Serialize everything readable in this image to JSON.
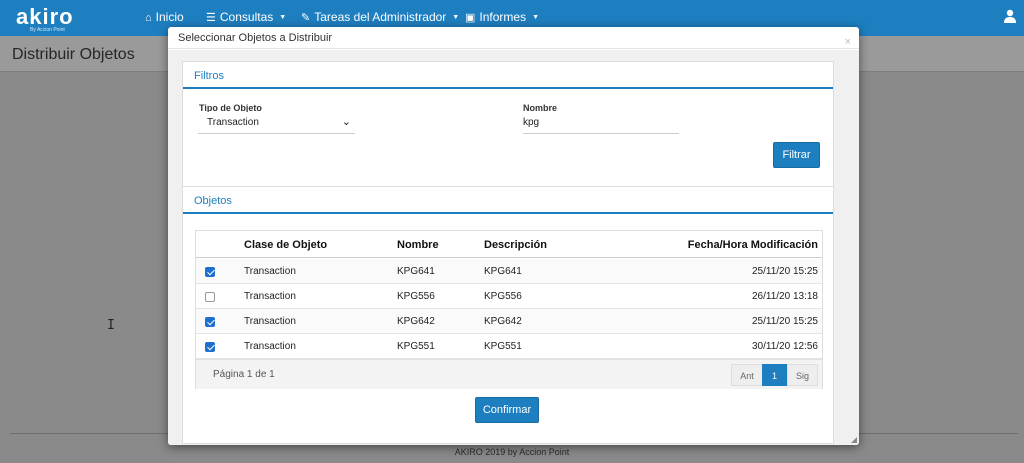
{
  "app": {
    "logo": "akiro",
    "logo_sub": "By Accion Point"
  },
  "nav": [
    {
      "icon": "home-icon",
      "glyph": "⌂",
      "label": "Inicio"
    },
    {
      "icon": "list-icon",
      "glyph": "☰",
      "label": "Consultas"
    },
    {
      "icon": "wrench-icon",
      "glyph": "✎",
      "label": "Tareas del Administrador"
    },
    {
      "icon": "briefcase-icon",
      "glyph": "▣",
      "label": "Informes"
    }
  ],
  "page": {
    "title": "Distribuir Objetos"
  },
  "footer": {
    "text": "AKIRO 2019 by Accion Point"
  },
  "modal": {
    "title": "Seleccionar Objetos a Distribuir",
    "close": "×",
    "filters": {
      "title": "Filtros",
      "type_label": "Tipo de Objeto",
      "type_value": "Transaction",
      "name_label": "Nombre",
      "name_value": "kpg",
      "button": "Filtrar"
    },
    "objects": {
      "title": "Objetos",
      "columns": [
        "Clase de Objeto",
        "Nombre",
        "Descripción",
        "Fecha/Hora Modificación"
      ],
      "rows": [
        {
          "checked": true,
          "clase": "Transaction",
          "nombre": "KPG641",
          "descripcion": "KPG641",
          "fecha": "25/11/20 15:25"
        },
        {
          "checked": false,
          "clase": "Transaction",
          "nombre": "KPG556",
          "descripcion": "KPG556",
          "fecha": "26/11/20 13:18"
        },
        {
          "checked": true,
          "clase": "Transaction",
          "nombre": "KPG642",
          "descripcion": "KPG642",
          "fecha": "25/11/20 15:25"
        },
        {
          "checked": true,
          "clase": "Transaction",
          "nombre": "KPG551",
          "descripcion": "KPG551",
          "fecha": "30/11/20 12:56"
        }
      ],
      "pager": {
        "info": "Página 1 de 1",
        "prev": "Ant",
        "current": "1",
        "next": "Sig"
      }
    },
    "confirm": "Confirmar"
  }
}
